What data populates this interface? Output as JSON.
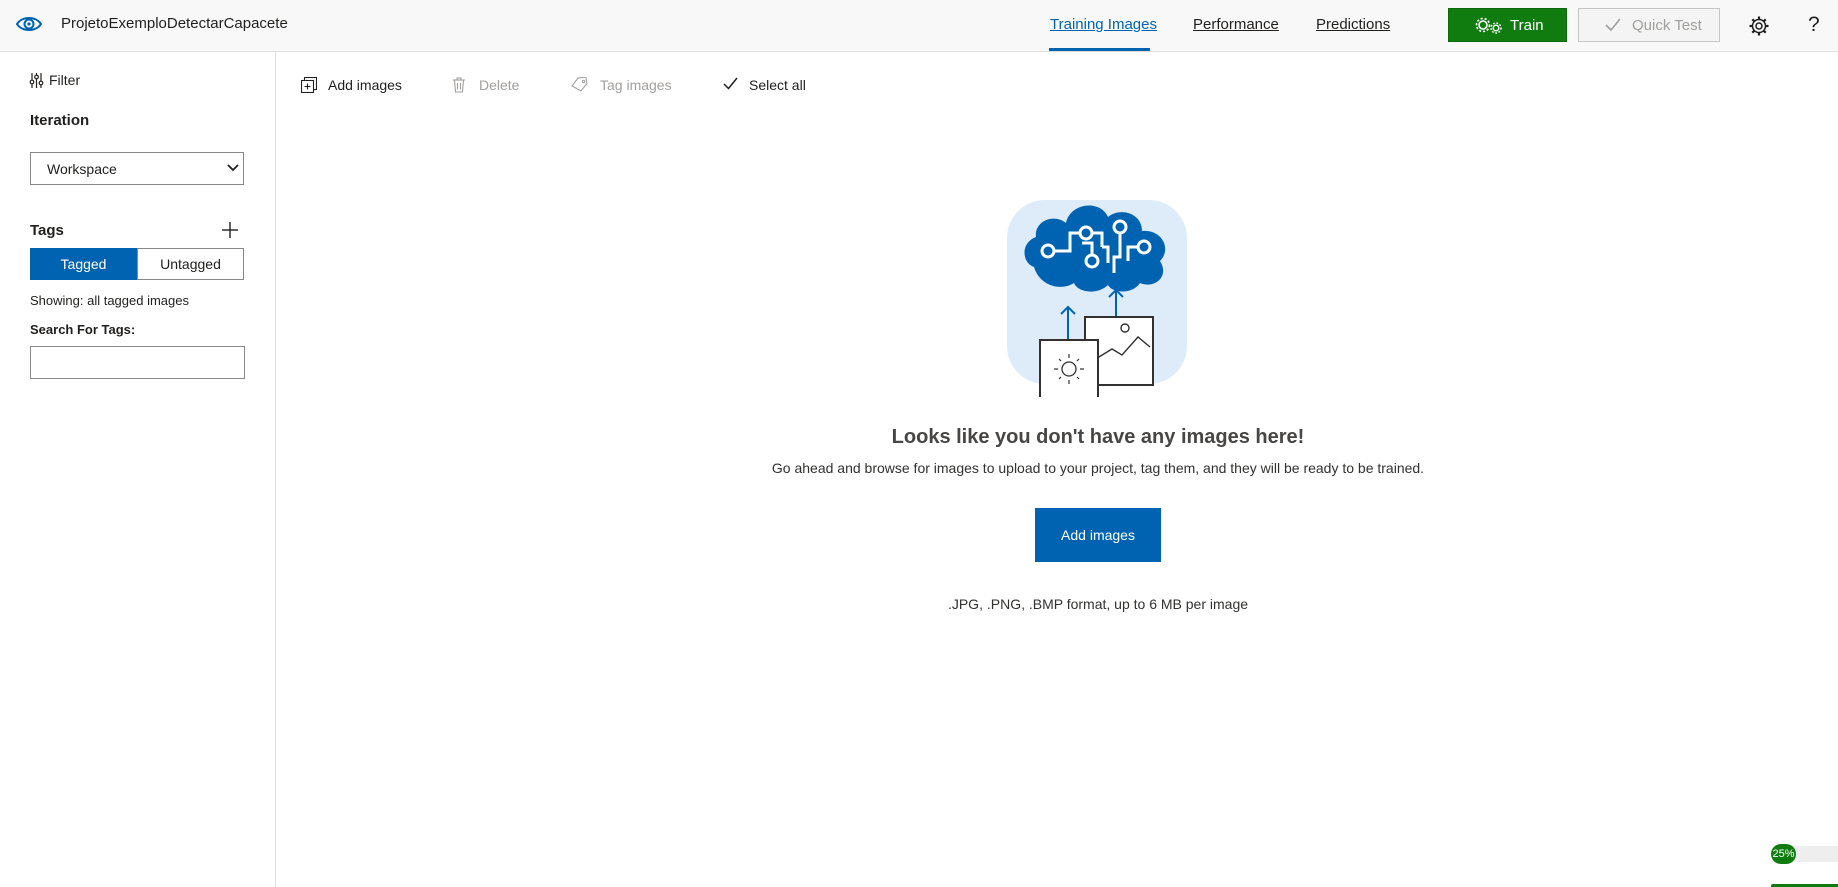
{
  "header": {
    "project_name": "ProjetoExemploDetectarCapacete",
    "tabs": [
      {
        "label": "Training Images",
        "active": true
      },
      {
        "label": "Performance",
        "active": false
      },
      {
        "label": "Predictions",
        "active": false
      }
    ],
    "train_label": "Train",
    "quick_test_label": "Quick Test",
    "help_label": "?"
  },
  "sidebar": {
    "filter_label": "Filter",
    "iteration_title": "Iteration",
    "iteration_value": "Workspace",
    "tags_title": "Tags",
    "segments": {
      "tagged": "Tagged",
      "untagged": "Untagged",
      "selected": "Tagged"
    },
    "showing_text": "Showing: all tagged images",
    "search_label": "Search For Tags:",
    "search_value": ""
  },
  "toolbar": {
    "add_images": "Add images",
    "delete": "Delete",
    "tag_images": "Tag images",
    "select_all": "Select all"
  },
  "empty_state": {
    "title": "Looks like you don't have any images here!",
    "subtitle": "Go ahead and browse for images to upload to your project, tag them, and they will be ready to be trained.",
    "cta_label": "Add images",
    "formats": ".JPG, .PNG, .BMP format, up to 6 MB per image"
  },
  "progress": {
    "label": "25%",
    "value": 0.25
  },
  "colors": {
    "accent": "#0063b1",
    "train_green": "#107c10",
    "hero_bg": "#deecf9",
    "disabled_text": "#a19f9d"
  }
}
